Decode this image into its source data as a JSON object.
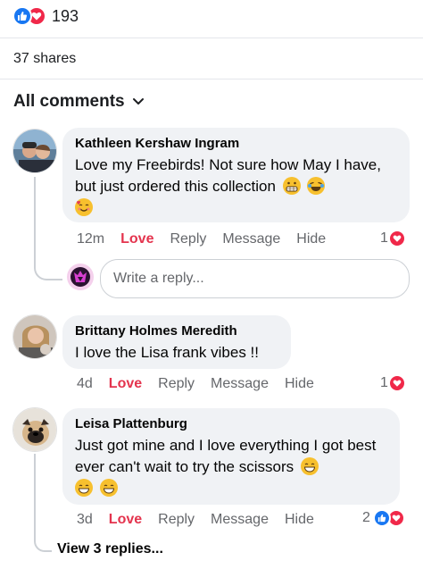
{
  "post": {
    "reaction_count": "193",
    "shares": "37 shares",
    "sort_label": "All comments"
  },
  "comments": [
    {
      "author": "Kathleen Kershaw Ingram",
      "text": "Love my Freebirds! Not sure how May I have, but just ordered this collection",
      "time": "12m",
      "love": "Love",
      "reply": "Reply",
      "message": "Message",
      "hide": "Hide",
      "reaction_count": "1",
      "emojis": [
        "grimacing-emoji",
        "laughing-tears-emoji",
        "smiling-hearts-emoji"
      ]
    },
    {
      "author": "Brittany Holmes Meredith",
      "text": "I love the Lisa frank vibes !!",
      "time": "4d",
      "love": "Love",
      "reply": "Reply",
      "message": "Message",
      "hide": "Hide",
      "reaction_count": "1"
    },
    {
      "author": "Leisa Plattenburg",
      "text": "Just got mine and I love everything I got best ever can't wait to try the scissors",
      "time": "3d",
      "love": "Love",
      "reply": "Reply",
      "message": "Message",
      "hide": "Hide",
      "reaction_count": "2",
      "emojis": [
        "grinning-emoji",
        "grinning-emoji",
        "grinning-emoji"
      ]
    }
  ],
  "reply_box": {
    "placeholder": "Write a reply..."
  },
  "view_replies": "View 3 replies...",
  "colors": {
    "like": "#1877f2",
    "love": "#f02849",
    "love_text": "#e4344e",
    "bubble": "#f0f2f5"
  }
}
